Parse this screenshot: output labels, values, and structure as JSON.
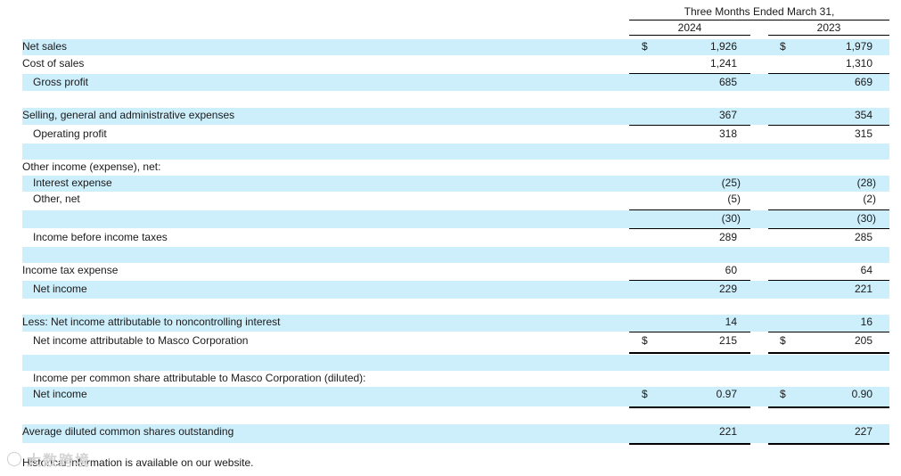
{
  "header": {
    "period": "Three Months Ended March 31,",
    "year_1": "2024",
    "year_2": "2023"
  },
  "rows": [
    {
      "label": "Net sales",
      "cur1": "$",
      "v1": "1,926",
      "cur2": "$",
      "v2": "1,979"
    },
    {
      "label": "Cost of sales",
      "v1": "1,241",
      "v2": "1,310"
    },
    {
      "label": "Gross profit",
      "v1": "685",
      "v2": "669"
    },
    {
      "label": "Selling, general and administrative expenses",
      "v1": "367",
      "v2": "354"
    },
    {
      "label": "Operating profit",
      "v1": "318",
      "v2": "315"
    },
    {
      "label": "Other income (expense), net:"
    },
    {
      "label": "Interest expense",
      "v1": "(25)",
      "v2": "(28)"
    },
    {
      "label": "Other, net",
      "v1": "(5)",
      "v2": "(2)"
    },
    {
      "label": "",
      "v1": "(30)",
      "v2": "(30)"
    },
    {
      "label": "Income before income taxes",
      "v1": "289",
      "v2": "285"
    },
    {
      "label": "Income tax expense",
      "v1": "60",
      "v2": "64"
    },
    {
      "label": "Net income",
      "v1": "229",
      "v2": "221"
    },
    {
      "label": "Less: Net income attributable to noncontrolling interest",
      "v1": "14",
      "v2": "16"
    },
    {
      "label": "Net income attributable to Masco Corporation",
      "cur1": "$",
      "v1": "215",
      "cur2": "$",
      "v2": "205"
    },
    {
      "label": "Income per common share attributable to Masco Corporation (diluted):"
    },
    {
      "label": "Net income",
      "cur1": "$",
      "v1": "0.97",
      "cur2": "$",
      "v2": "0.90"
    },
    {
      "label": "Average diluted common shares outstanding",
      "v1": "221",
      "v2": "227"
    }
  ],
  "footer": "Historical information is available on our website.",
  "watermark": "大数跨境"
}
